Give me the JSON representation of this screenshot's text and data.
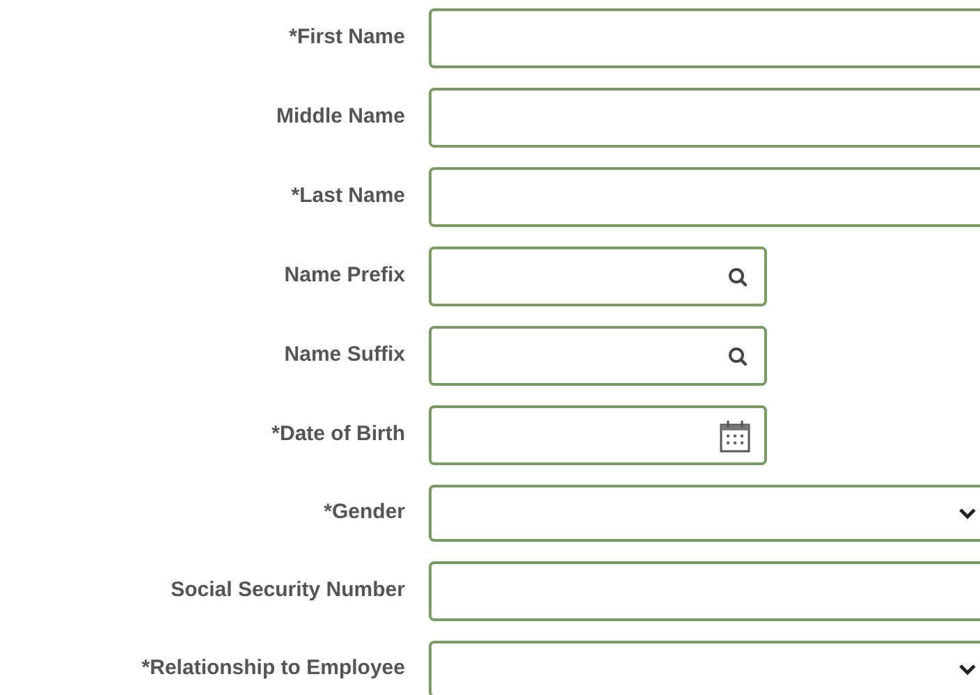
{
  "fields": [
    {
      "label": "*First Name",
      "kind": "text"
    },
    {
      "label": "Middle Name",
      "kind": "text"
    },
    {
      "label": "*Last Name",
      "kind": "text"
    },
    {
      "label": "Name Prefix",
      "kind": "lookup"
    },
    {
      "label": "Name Suffix",
      "kind": "lookup"
    },
    {
      "label": "*Date of Birth",
      "kind": "date"
    },
    {
      "label": "*Gender",
      "kind": "select"
    },
    {
      "label": "Social Security Number",
      "kind": "text"
    },
    {
      "label": "*Relationship to Employee",
      "kind": "select"
    }
  ]
}
